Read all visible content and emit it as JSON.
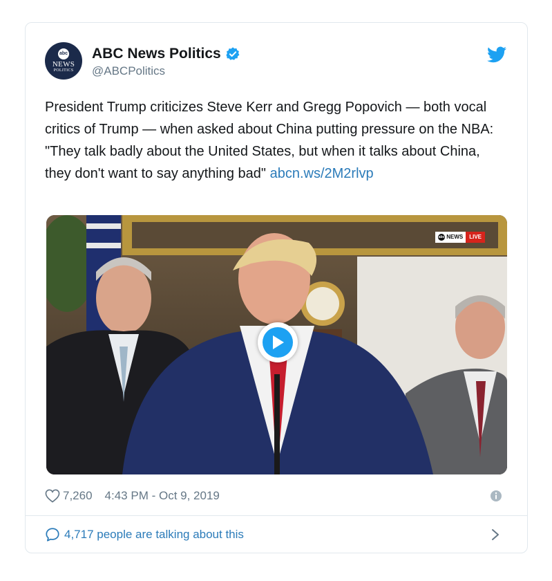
{
  "account": {
    "display_name": "ABC News Politics",
    "handle": "@ABCPolitics",
    "avatar": {
      "logo_text": "abc",
      "line1": "NEWS",
      "line2": "POLITICS"
    },
    "verified_icon": "verified-badge-icon",
    "platform_icon": "twitter-bird-icon"
  },
  "tweet": {
    "text": "President Trump criticizes Steve Kerr and Gregg Popovich — both vocal critics of Trump — when asked about China putting pressure on the NBA: \"They talk badly about the United States, but when it talks about China, they don't want to say anything bad\"",
    "link": "abcn.ws/2M2rlvp"
  },
  "media": {
    "type": "video",
    "overlay": {
      "brand": "NEWS",
      "brand_logo": "abc",
      "live_label": "LIVE"
    },
    "play_icon": "play-icon"
  },
  "meta": {
    "likes": "7,260",
    "timestamp": "4:43 PM - Oct 9, 2019",
    "heart_icon": "heart-icon",
    "info_icon": "info-icon"
  },
  "footer": {
    "talking_text": "4,717 people are talking about this",
    "bubble_icon": "speech-bubble-icon",
    "chevron_icon": "chevron-right-icon"
  },
  "colors": {
    "link": "#2b7bb9",
    "twitter_blue": "#1da1f2",
    "muted": "#657786",
    "border": "#e1e8ed",
    "live_red": "#d6241c"
  }
}
